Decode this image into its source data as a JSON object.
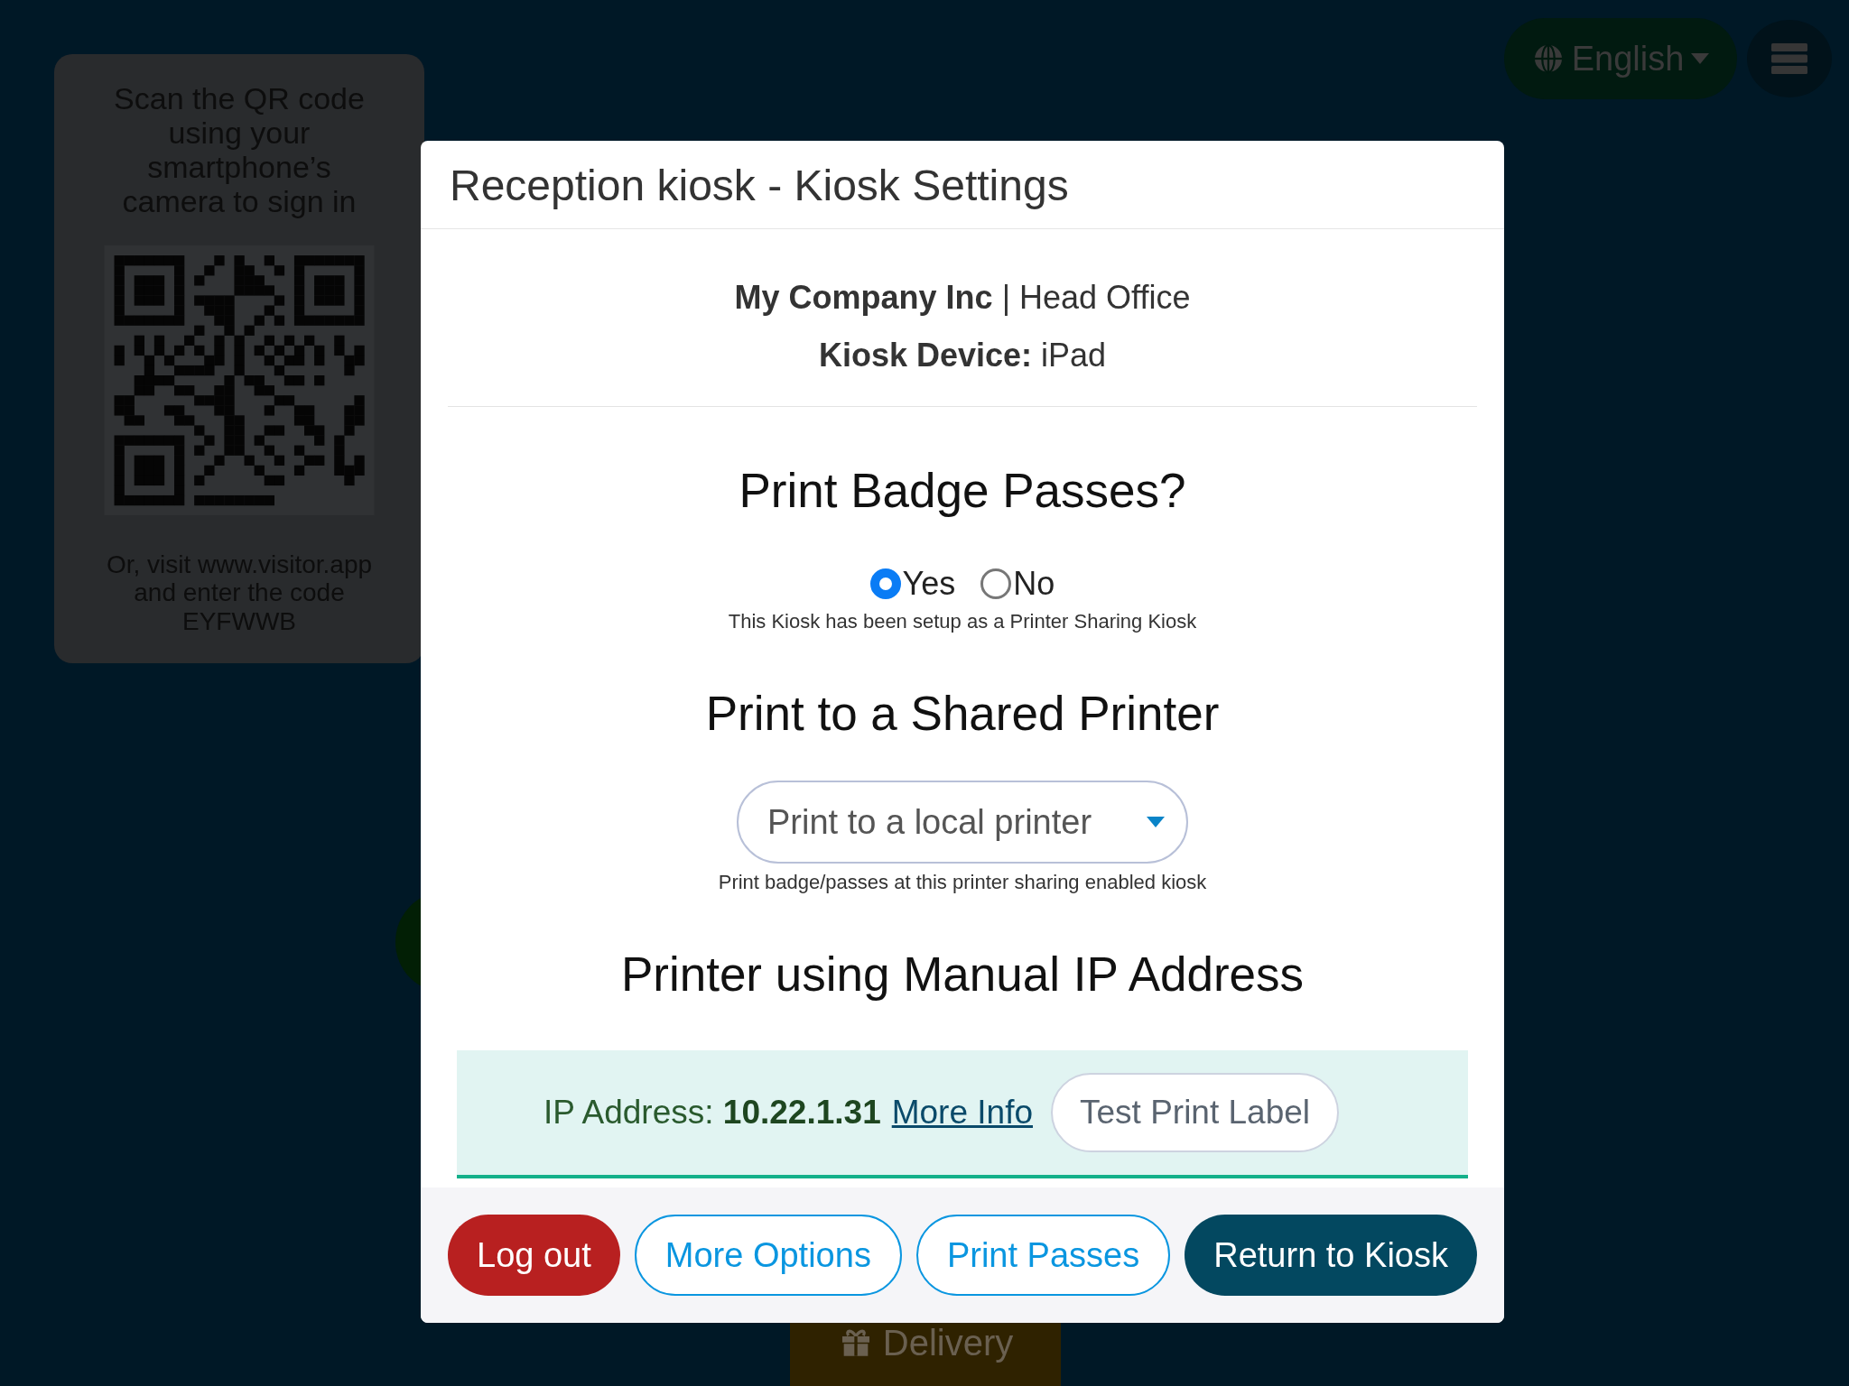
{
  "background": {
    "qr_card": {
      "instructions": "Scan the QR code using your smartphone’s camera to sign in",
      "visit_text": "Or, visit www.visitor.app and enter the code",
      "code": "EYFWWB"
    },
    "language_button": {
      "label": "English"
    },
    "delivery_button": {
      "label": "Delivery"
    }
  },
  "modal": {
    "title": "Reception kiosk - Kiosk Settings",
    "company_line": "**My Company Inc** | Head Office",
    "device_line": "**Kiosk Device:** iPad",
    "badge_section": {
      "heading": "Print Badge Passes?",
      "options": [
        {
          "label": "Yes",
          "selected": true
        },
        {
          "label": "No",
          "selected": false
        }
      ],
      "note": "This Kiosk has been setup as a Printer Sharing Kiosk"
    },
    "shared_printer_section": {
      "heading": "Print to a Shared Printer",
      "select_value": "Print to a local printer",
      "note": "Print badge/passes at this printer sharing enabled kiosk"
    },
    "ip_section": {
      "heading": "Printer using Manual IP Address",
      "ip_text": "IP Address: **10.22.1.31**",
      "link": "More Info",
      "button": "Test Print Label"
    },
    "footer_buttons": [
      {
        "label": "Log out",
        "kind": "danger"
      },
      {
        "label": "More Options",
        "kind": "outline"
      },
      {
        "label": "Print Passes",
        "kind": "outline"
      },
      {
        "label": "Return to Kiosk",
        "kind": "primary"
      }
    ]
  }
}
